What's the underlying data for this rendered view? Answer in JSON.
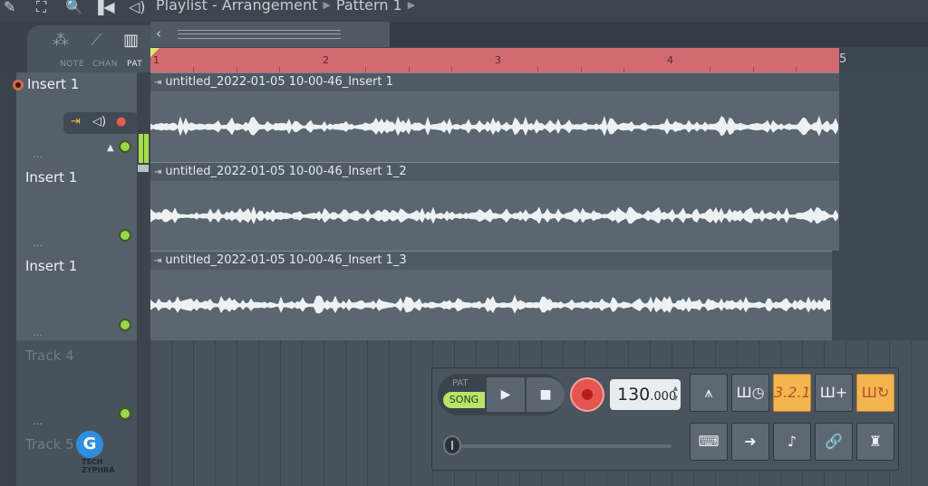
{
  "titlebar": {
    "crumb_1": "Playlist - Arrangement",
    "crumb_2": "Pattern 1"
  },
  "modes": {
    "note": "NOTE",
    "chan": "CHAN",
    "pat": "PAT"
  },
  "ruler": {
    "bars": [
      "2",
      "3",
      "4",
      "5"
    ]
  },
  "tracks": [
    {
      "name": "Insert 1",
      "clip": "untitled_2022-01-05 10-00-46_Insert 1"
    },
    {
      "name": "Insert 1",
      "clip": "untitled_2022-01-05 10-00-46_Insert 1_2"
    },
    {
      "name": "Insert 1",
      "clip": "untitled_2022-01-05 10-00-46_Insert 1_3"
    },
    {
      "name": "Track 4"
    },
    {
      "name": "Track 5"
    }
  ],
  "transport": {
    "pat_label": "PAT",
    "song_label": "SONG",
    "tempo_int": "130",
    "tempo_dec": ".000",
    "countdown_label": "3.2.1"
  },
  "watermark": {
    "line1": "TECH",
    "line2": "ZYPHRA"
  },
  "colors": {
    "ruler": "#d26a72",
    "accent_green": "#97d84c",
    "toggle_on": "#f3b550",
    "record": "#e35652"
  }
}
